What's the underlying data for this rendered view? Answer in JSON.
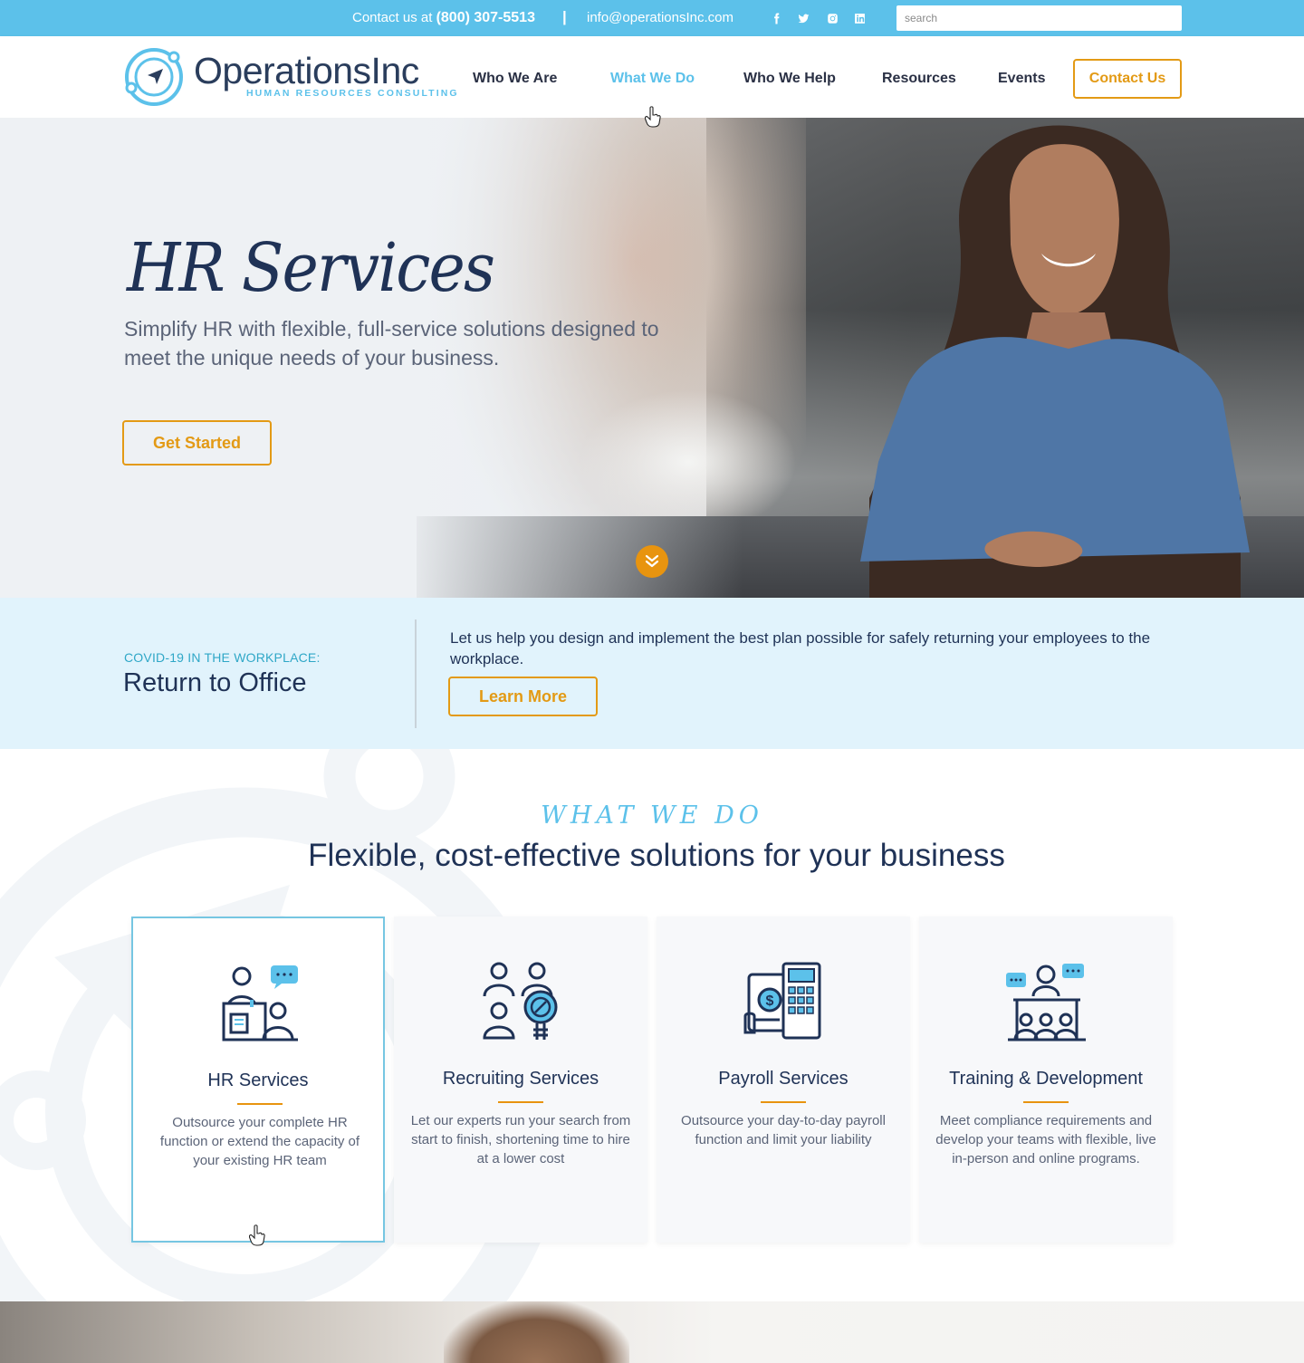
{
  "topbar": {
    "contact_prefix": "Contact us at",
    "phone": "(800) 307-5513",
    "separator": "|",
    "email": "info@operationsInc.com",
    "social_icons": [
      "facebook-icon",
      "twitter-icon",
      "instagram-icon",
      "linkedin-icon"
    ],
    "search_placeholder": "search"
  },
  "header": {
    "logo_name": "OperationsInc",
    "logo_tagline": "HUMAN RESOURCES CONSULTING",
    "nav": [
      {
        "label": "Who We Are"
      },
      {
        "label": "What We Do"
      },
      {
        "label": "Who We Help"
      },
      {
        "label": "Resources"
      },
      {
        "label": "Events"
      }
    ],
    "contact_button": "Contact Us"
  },
  "hero": {
    "title": "HR Services",
    "subtitle": "Simplify HR with flexible, full-service solutions designed to meet the unique needs of your business.",
    "cta": "Get Started"
  },
  "covid": {
    "kicker": "COVID-19 IN THE WORKPLACE:",
    "title": "Return to Office",
    "text": "Let us help you design and implement the best plan possible for safely returning your employees to the workplace.",
    "cta": "Learn More"
  },
  "what_we_do": {
    "kicker": "WHAT WE DO",
    "title": "Flexible, cost-effective solutions for your business",
    "cards": [
      {
        "name": "HR Services",
        "description": "Outsource your complete HR function or extend the capacity of your existing HR team",
        "icon": "hr-consultant-icon"
      },
      {
        "name": "Recruiting Services",
        "description": "Let our experts run your search from start to finish, shortening time to hire at a lower cost",
        "icon": "recruiting-candidates-icon"
      },
      {
        "name": "Payroll Services",
        "description": "Outsource your day-to-day payroll function and limit your liability",
        "icon": "payroll-calculator-icon"
      },
      {
        "name": "Training & Development",
        "description": "Meet compliance requirements and develop your teams with flexible, live in-person and online programs.",
        "icon": "training-presenter-icon"
      }
    ]
  },
  "colors": {
    "accent_blue": "#5cc1ea",
    "accent_orange": "#e39a15",
    "navy": "#1f3256"
  }
}
